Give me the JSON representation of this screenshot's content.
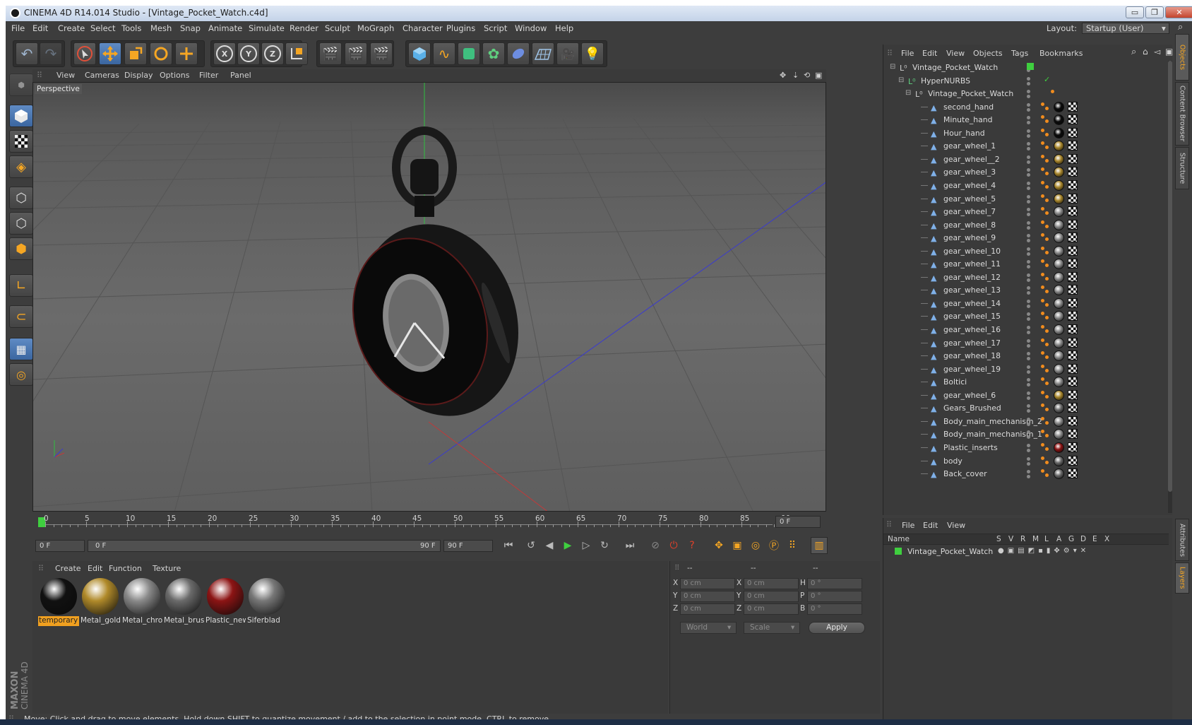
{
  "window": {
    "title": "CINEMA 4D R14.014 Studio - [Vintage_Pocket_Watch.c4d]",
    "minimize": "▭",
    "restore": "❐",
    "close": "✕"
  },
  "menubar": [
    "File",
    "Edit",
    "Create",
    "Select",
    "Tools",
    "Mesh",
    "Snap",
    "Animate",
    "Simulate",
    "Render",
    "Sculpt",
    "MoGraph",
    "Character",
    "Plugins",
    "Script",
    "Window",
    "Help"
  ],
  "layout": {
    "label": "Layout:",
    "value": "Startup (User)"
  },
  "viewport": {
    "menu": [
      "View",
      "Cameras",
      "Display",
      "Options",
      "Filter",
      "Panel"
    ],
    "label": "Perspective"
  },
  "timeline": {
    "ticks": [
      "0",
      "5",
      "10",
      "15",
      "20",
      "25",
      "30",
      "35",
      "40",
      "45",
      "50",
      "55",
      "60",
      "65",
      "70",
      "75",
      "80",
      "85",
      "90"
    ],
    "current_frame": "0 F",
    "start_field": "0 F",
    "slider_start": "0 F",
    "slider_end": "90 F",
    "end_field": "90 F"
  },
  "materials": {
    "menu": [
      "Create",
      "Edit",
      "Function",
      "Texture"
    ],
    "items": [
      {
        "name": "temporary",
        "color": "#111111"
      },
      {
        "name": "Metal_gold",
        "color": "#b08a2a"
      },
      {
        "name": "Metal_chrome",
        "color": "#8a8a8a"
      },
      {
        "name": "Metal_brushed",
        "color": "#6a6a6a"
      },
      {
        "name": "Plastic_new",
        "color": "#8c1414"
      },
      {
        "name": "Siferblad",
        "color": "#777777"
      }
    ]
  },
  "coords": {
    "headers": [
      "--",
      "--",
      "--"
    ],
    "rows": [
      {
        "a": "X",
        "av": "0 cm",
        "b": "X",
        "bv": "0 cm",
        "c": "H",
        "cv": "0 °"
      },
      {
        "a": "Y",
        "av": "0 cm",
        "b": "Y",
        "bv": "0 cm",
        "c": "P",
        "cv": "0 °"
      },
      {
        "a": "Z",
        "av": "0 cm",
        "b": "Z",
        "bv": "0 cm",
        "c": "B",
        "cv": "0 °"
      }
    ],
    "mode1": "World",
    "mode2": "Scale",
    "apply": "Apply"
  },
  "objects": {
    "menu": [
      "File",
      "Edit",
      "View",
      "Objects",
      "Tags",
      "Bookmarks"
    ],
    "root": "Vintage_Pocket_Watch",
    "nurbs": "HyperNURBS",
    "group": "Vintage_Pocket_Watch",
    "children": [
      {
        "name": "second_hand",
        "tag": "#0c0c0c"
      },
      {
        "name": "Minute_hand",
        "tag": "#0c0c0c"
      },
      {
        "name": "Hour_hand",
        "tag": "#0c0c0c"
      },
      {
        "name": "gear_wheel_1",
        "tag": "#a8862c"
      },
      {
        "name": "gear_wheel__2",
        "tag": "#a8862c"
      },
      {
        "name": "gear_wheel_3",
        "tag": "#a8862c"
      },
      {
        "name": "gear_wheel_4",
        "tag": "#a8862c"
      },
      {
        "name": "gear_wheel_5",
        "tag": "#a8862c"
      },
      {
        "name": "gear_wheel_7",
        "tag": "#8a8a8a"
      },
      {
        "name": "gear_wheel_8",
        "tag": "#8a8a8a"
      },
      {
        "name": "gear_wheel_9",
        "tag": "#8a8a8a"
      },
      {
        "name": "gear_wheel_10",
        "tag": "#8a8a8a"
      },
      {
        "name": "gear_wheel_11",
        "tag": "#8a8a8a"
      },
      {
        "name": "gear_wheel_12",
        "tag": "#8a8a8a"
      },
      {
        "name": "gear_wheel_13",
        "tag": "#8a8a8a"
      },
      {
        "name": "gear_wheel_14",
        "tag": "#8a8a8a"
      },
      {
        "name": "gear_wheel_15",
        "tag": "#8a8a8a"
      },
      {
        "name": "gear_wheel_16",
        "tag": "#8a8a8a"
      },
      {
        "name": "gear_wheel_17",
        "tag": "#8a8a8a"
      },
      {
        "name": "gear_wheel_18",
        "tag": "#8a8a8a"
      },
      {
        "name": "gear_wheel_19",
        "tag": "#8a8a8a"
      },
      {
        "name": "Boltici",
        "tag": "#8a8a8a"
      },
      {
        "name": "gear_wheel_6",
        "tag": "#a8862c"
      },
      {
        "name": "Gears_Brushed",
        "tag": "#6a6a6a"
      },
      {
        "name": "Body_main_mechanism_2",
        "tag": "#8a8a8a"
      },
      {
        "name": "Body_main_mechanism_1",
        "tag": "#8a8a8a"
      },
      {
        "name": "Plastic_inserts",
        "tag": "#8c1414"
      },
      {
        "name": "body",
        "tag": "#6a6a6a"
      },
      {
        "name": "Back_cover",
        "tag": "#6a6a6a"
      }
    ]
  },
  "layers": {
    "menu": [
      "File",
      "Edit",
      "View"
    ],
    "header_name": "Name",
    "header_cols": [
      "S",
      "V",
      "R",
      "M",
      "L",
      "A",
      "G",
      "D",
      "E",
      "X"
    ],
    "item": "Vintage_Pocket_Watch"
  },
  "sidetabs": [
    "Objects",
    "Content Browser",
    "Structure",
    "Attributes",
    "Layers"
  ],
  "status": "Move: Click and drag to move elements. Hold down SHIFT to quantize movement / add to the selection in point mode, CTRL to remove.",
  "brand": {
    "maxon": "MAXON",
    "product": "CINEMA 4D"
  }
}
